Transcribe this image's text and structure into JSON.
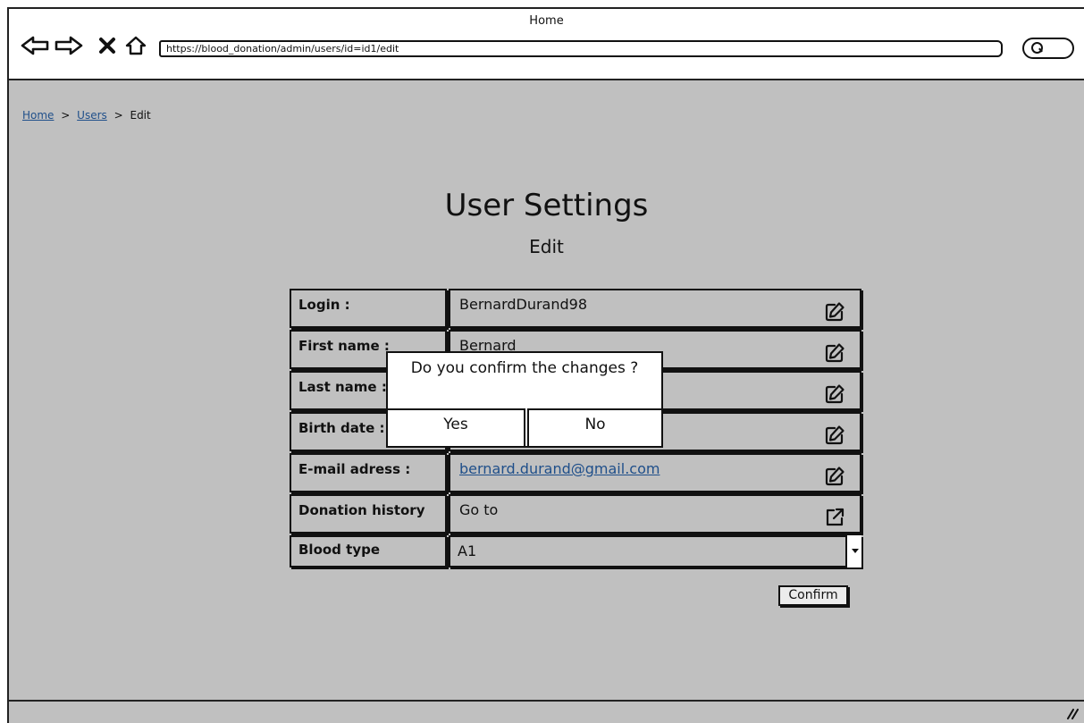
{
  "window": {
    "title": "Home"
  },
  "browser": {
    "url": "https://blood_donation/admin/users/id=id1/edit",
    "icons": [
      "back-arrow-icon",
      "forward-arrow-icon",
      "close-x-icon",
      "home-icon",
      "search-icon"
    ]
  },
  "breadcrumb": {
    "home": "Home",
    "users": "Users",
    "current": "Edit",
    "separator": ">"
  },
  "page": {
    "title": "User Settings",
    "subtitle": "Edit"
  },
  "form": {
    "login": {
      "label": "Login :",
      "value": "BernardDurand98"
    },
    "first_name": {
      "label": "First name :",
      "value": "Bernard"
    },
    "last_name": {
      "label": "Last name :",
      "value": ""
    },
    "birth_date": {
      "label": "Birth date :",
      "value": ""
    },
    "email": {
      "label": "E-mail adress :",
      "value": "bernard.durand@gmail.com"
    },
    "donation_history": {
      "label": "Donation history",
      "value": "Go to"
    },
    "blood_type": {
      "label": "Blood type",
      "value": "A1"
    },
    "confirm_label": "Confirm"
  },
  "modal": {
    "message": "Do you confirm the changes ?",
    "yes_label": "Yes",
    "no_label": "No"
  },
  "colors": {
    "background": "#c0c0c0",
    "link": "#1f4f8a",
    "border": "#111111"
  }
}
